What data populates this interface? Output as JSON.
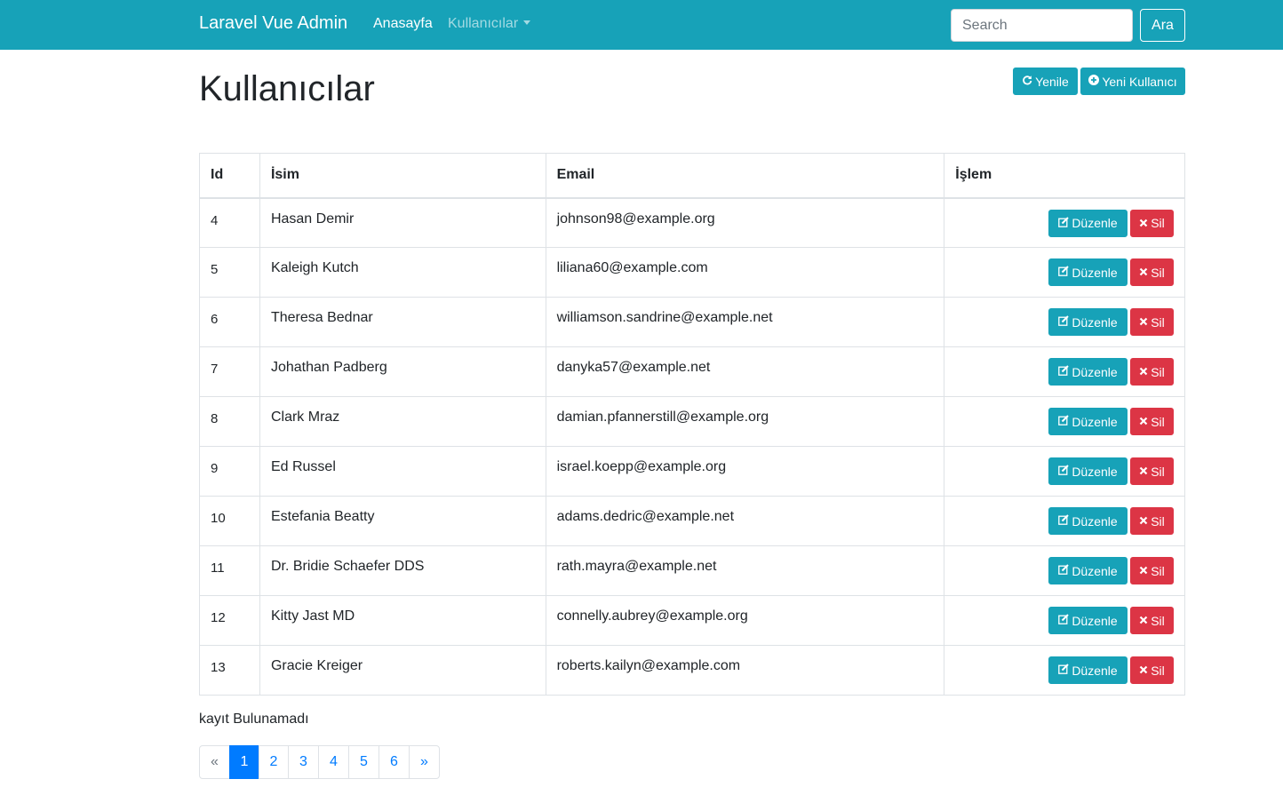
{
  "navbar": {
    "brand": "Laravel Vue Admin",
    "links": [
      {
        "label": "Anasayfa"
      },
      {
        "label": "Kullanıcılar"
      }
    ],
    "search_placeholder": "Search",
    "search_button": "Ara"
  },
  "page": {
    "title": "Kullanıcılar",
    "refresh_label": "Yenile",
    "new_user_label": "Yeni Kullanıcı"
  },
  "table": {
    "headers": [
      "Id",
      "İsim",
      "Email",
      "İşlem"
    ],
    "edit_label": "Düzenle",
    "delete_label": "Sil",
    "rows": [
      {
        "id": "4",
        "name": "Hasan Demir",
        "email": "johnson98@example.org"
      },
      {
        "id": "5",
        "name": "Kaleigh Kutch",
        "email": "liliana60@example.com"
      },
      {
        "id": "6",
        "name": "Theresa Bednar",
        "email": "williamson.sandrine@example.net"
      },
      {
        "id": "7",
        "name": "Johathan Padberg",
        "email": "danyka57@example.net"
      },
      {
        "id": "8",
        "name": "Clark Mraz",
        "email": "damian.pfannerstill@example.org"
      },
      {
        "id": "9",
        "name": "Ed Russel",
        "email": "israel.koepp@example.org"
      },
      {
        "id": "10",
        "name": "Estefania Beatty",
        "email": "adams.dedric@example.net"
      },
      {
        "id": "11",
        "name": "Dr. Bridie Schaefer DDS",
        "email": "rath.mayra@example.net"
      },
      {
        "id": "12",
        "name": "Kitty Jast MD",
        "email": "connelly.aubrey@example.org"
      },
      {
        "id": "13",
        "name": "Gracie Kreiger",
        "email": "roberts.kailyn@example.com"
      }
    ]
  },
  "empty_text": "kayıt Bulunamadı",
  "pagination": {
    "prev": "«",
    "pages": [
      "1",
      "2",
      "3",
      "4",
      "5",
      "6"
    ],
    "active": "1",
    "next": "»"
  },
  "colors": {
    "primary": "#17a2b8",
    "danger": "#dc3545",
    "link": "#007bff"
  },
  "icons": {
    "refresh": "refresh-icon",
    "new_user": "plus-circle-icon",
    "edit": "edit-icon",
    "delete": "close-icon"
  }
}
